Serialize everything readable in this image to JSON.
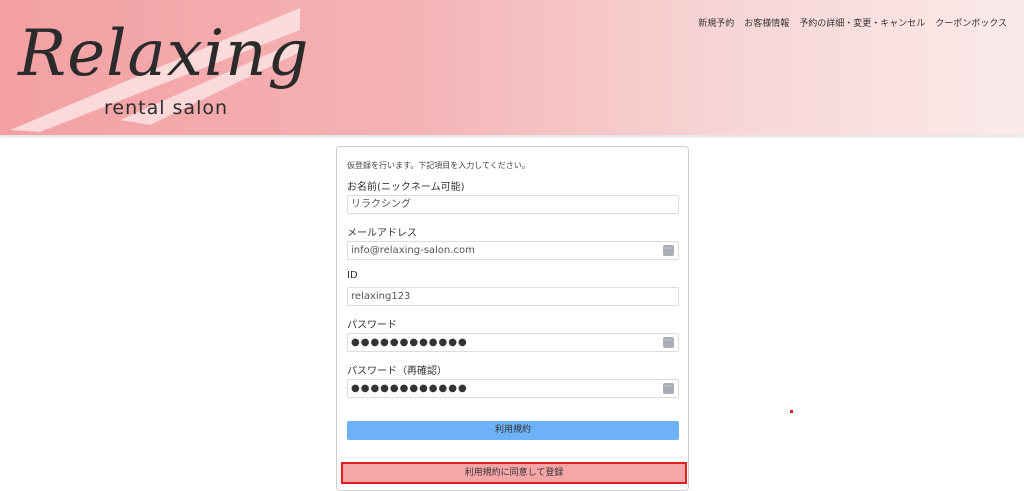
{
  "brand": {
    "script": "Relaxing",
    "sub": "rental salon"
  },
  "nav": {
    "items": [
      "新規予約",
      "お客様情報",
      "予約の詳細・変更・キャンセル",
      "クーポンボックス"
    ]
  },
  "form": {
    "intro": "仮登録を行います。下記項目を入力してください。",
    "name_label": "お名前(ニックネーム可能)",
    "name_value": "リラクシング",
    "email_label": "メールアドレス",
    "email_value": "info@relaxing-salon.com",
    "id_label": "ID",
    "id_value": "relaxing123",
    "password_label": "パスワード",
    "password_value": "●●●●●●●●●●●●",
    "password_confirm_label": "パスワード（再確認）",
    "password_confirm_value": "●●●●●●●●●●●●",
    "terms_button": "利用規約",
    "agree_button": "利用規約に同意して登録"
  },
  "colors": {
    "header_start": "#f3a0a3",
    "header_end": "#fbeaea",
    "terms_button": "#6db2f7",
    "agree_button": "#f7a6a8",
    "highlight_border": "#e02020"
  }
}
